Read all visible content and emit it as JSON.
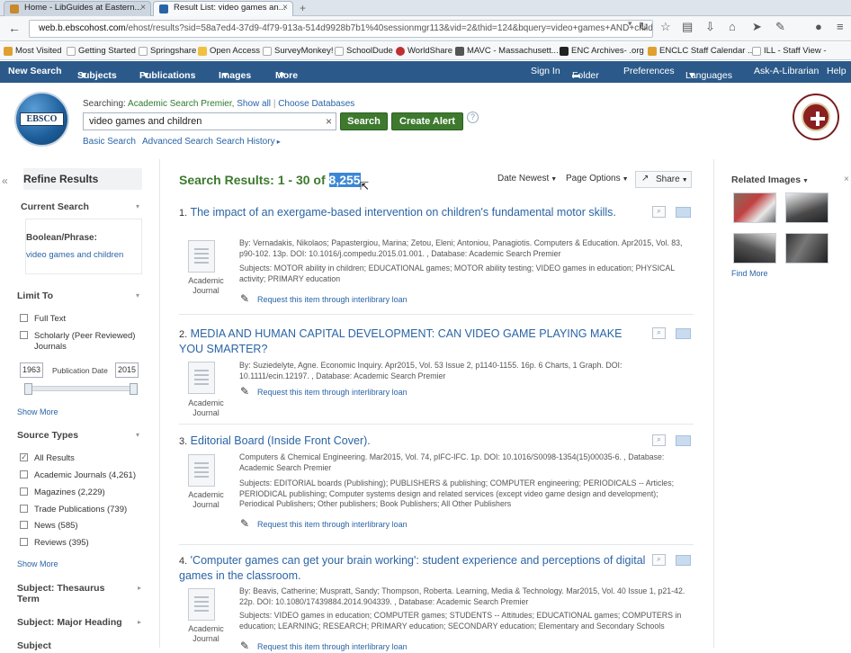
{
  "browser": {
    "tabs": [
      {
        "title": "Home - LibGuides at Eastern...",
        "active": false
      },
      {
        "title": "Result List: video games an...",
        "active": true
      }
    ],
    "url_domain": "web.b.ebscohost.com",
    "url_path": "/ehost/results?sid=58a7ed4-37d9-4f79-913a-514d9928b7b1%40sessionmgr113&vid=2&thid=124&bquery=video+games+AND+children&bda",
    "bookmarks": [
      "Most Visited",
      "Getting Started",
      "Springshare",
      "Open Access",
      "SurveyMonkey!",
      "SchoolDude",
      "WorldShare",
      "MAVC - Massachusett...",
      "ENC Archives- .org",
      "ENCLC Staff Calendar ...",
      "ILL - Staff View -"
    ]
  },
  "ebsco_nav": {
    "left": [
      "New Search",
      "Subjects",
      "Publications",
      "Images",
      "More"
    ],
    "right": [
      "Sign In",
      "Folder",
      "Preferences",
      "Languages",
      "Ask-A-Librarian",
      "Help"
    ]
  },
  "header": {
    "logo_text": "EBSCO",
    "searching_label": "Searching:",
    "database": "Academic Search Premier,",
    "show_all": "Show all",
    "choose_db": "Choose Databases",
    "query": "video games and children",
    "search_btn": "Search",
    "create_alert_btn": "Create Alert",
    "help": "?",
    "basic_search": "Basic Search",
    "advanced_search": "Advanced Search",
    "search_history": "Search History"
  },
  "sidebar": {
    "refine": "Refine Results",
    "current_search": "Current Search",
    "boolean_label": "Boolean/Phrase:",
    "boolean_value": "video games and children",
    "limit_to": "Limit To",
    "limits": [
      "Full Text",
      "Scholarly (Peer Reviewed) Journals"
    ],
    "year_from": "1963",
    "year_to": "2015",
    "pub_date_label": "Publication Date",
    "show_more": "Show More",
    "source_types": "Source Types",
    "sources": [
      {
        "label": "All Results",
        "checked": true
      },
      {
        "label": "Academic Journals (4,261)",
        "checked": false
      },
      {
        "label": "Magazines (2,229)",
        "checked": false
      },
      {
        "label": "Trade Publications (739)",
        "checked": false
      },
      {
        "label": "News (585)",
        "checked": false
      },
      {
        "label": "Reviews (395)",
        "checked": false
      }
    ],
    "subject_thesaurus": "Subject: Thesaurus Term",
    "subject_major": "Subject: Major Heading",
    "subject_more": "Subject"
  },
  "results_header": {
    "prefix": "Search Results: 1 - 30 of",
    "total": "8,255",
    "sort": "Date Newest",
    "page_options": "Page Options",
    "share": "Share"
  },
  "results": [
    {
      "num": "1.",
      "title": "The impact of an exergame-based intervention on children's fundamental motor skills.",
      "type_label": "Academic Journal",
      "byline": "By: Vernadakis, Nikolaos; Papastergiou, Marina; Zetou, Eleni; Antoniou, Panagiotis. Computers & Education. Apr2015, Vol. 83, p90-102. 13p. DOI: 10.1016/j.compedu.2015.01.001. , Database: Academic Search Premier",
      "subjects": "Subjects: MOTOR ability in children; EDUCATIONAL games; MOTOR ability testing; VIDEO games in education; PHYSICAL activity; PRIMARY education",
      "ill": "Request this item through interlibrary loan"
    },
    {
      "num": "2.",
      "title": "MEDIA AND HUMAN CAPITAL DEVELOPMENT: CAN VIDEO GAME PLAYING MAKE YOU SMARTER?",
      "type_label": "Academic Journal",
      "byline": "By: Suziedelyte, Agne. Economic Inquiry. Apr2015, Vol. 53 Issue 2, p1140-1155. 16p. 6 Charts, 1 Graph. DOI: 10.1111/ecin.12197. , Database: Academic Search Premier",
      "subjects": "",
      "ill": "Request this item through interlibrary loan"
    },
    {
      "num": "3.",
      "title": "Editorial Board (Inside Front Cover).",
      "type_label": "Academic Journal",
      "byline": "Computers & Chemical Engineering. Mar2015, Vol. 74, pIFC-IFC. 1p. DOI: 10.1016/S0098-1354(15)00035-6. , Database: Academic Search Premier",
      "subjects": "Subjects: EDITORIAL boards (Publishing); PUBLISHERS & publishing; COMPUTER engineering; PERIODICALS -- Articles; PERIODICAL publishing; Computer systems design and related services (except video game design and development); Periodical Publishers; Other publishers; Book Publishers; All Other Publishers",
      "ill": "Request this item through interlibrary loan"
    },
    {
      "num": "4.",
      "title": "'Computer games can get your brain working': student experience and perceptions of digital games in the classroom.",
      "type_label": "Academic Journal",
      "byline": "By: Beavis, Catherine; Muspratt, Sandy; Thompson, Roberta. Learning, Media & Technology. Mar2015, Vol. 40 Issue 1, p21-42. 22p. DOI: 10.1080/17439884.2014.904339. , Database: Academic Search Premier",
      "subjects": "Subjects: VIDEO games in education; COMPUTER games; STUDENTS -- Attitudes; EDUCATIONAL games; COMPUTERS in education; LEARNING; RESEARCH; PRIMARY education; SECONDARY education; Elementary and Secondary Schools",
      "ill": "Request this item through interlibrary loan"
    }
  ],
  "right_panel": {
    "related_images": "Related Images",
    "find_more": "Find More"
  }
}
